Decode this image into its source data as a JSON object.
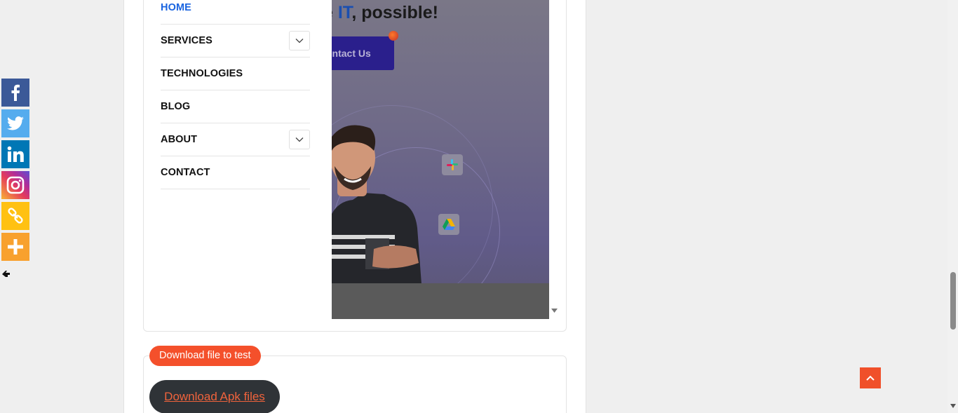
{
  "nav": {
    "items": [
      {
        "label": "HOME",
        "has_submenu": false,
        "active": true
      },
      {
        "label": "SERVICES",
        "has_submenu": true,
        "active": false
      },
      {
        "label": "TECHNOLOGIES",
        "has_submenu": false,
        "active": false
      },
      {
        "label": "BLOG",
        "has_submenu": false,
        "active": false
      },
      {
        "label": "ABOUT",
        "has_submenu": true,
        "active": false
      },
      {
        "label": "CONTACT",
        "has_submenu": false,
        "active": false
      }
    ]
  },
  "hero": {
    "headline_prefix": "e ",
    "headline_highlight": "IT",
    "headline_suffix": ", possible!",
    "cta_label": "ontact Us",
    "app_icons": [
      "slack-icon",
      "google-drive-icon"
    ]
  },
  "share": {
    "buttons": [
      {
        "name": "facebook",
        "color": "#3b5998",
        "icon": "facebook-icon"
      },
      {
        "name": "twitter",
        "color": "#55acee",
        "icon": "twitter-icon"
      },
      {
        "name": "linkedin",
        "color": "#0077b5",
        "icon": "linkedin-icon"
      },
      {
        "name": "instagram",
        "color": "#c13584",
        "icon": "instagram-icon"
      },
      {
        "name": "copy-link",
        "color": "#ffc112",
        "icon": "link-icon"
      },
      {
        "name": "more",
        "color": "#f8a12e",
        "icon": "plus-icon"
      }
    ],
    "hide_icon": "hand-point-left-icon"
  },
  "download": {
    "badge_label": "Download file to test",
    "button_label": "Download Apk files"
  },
  "colors": {
    "accent_orange": "#f4502b",
    "link_blue": "#1a64e0",
    "dark_button": "#2f3337"
  }
}
